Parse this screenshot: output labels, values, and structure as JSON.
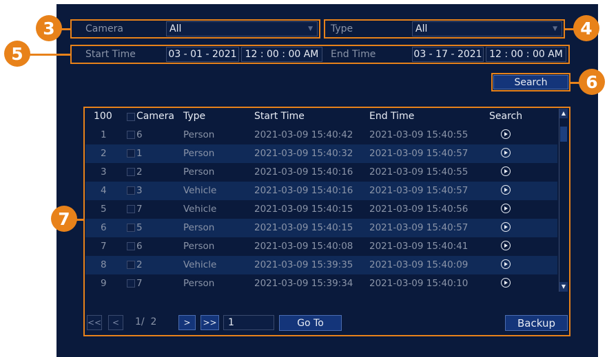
{
  "filters": {
    "camera_label": "Camera",
    "camera_value": "All",
    "type_label": "Type",
    "type_value": "All",
    "start_label": "Start Time",
    "start_date": "03 - 01 - 2021",
    "start_time": "12 : 00 : 00 AM",
    "end_label": "End Time",
    "end_date": "03 - 17 - 2021",
    "end_time": "12 : 00 : 00 AM"
  },
  "search_button": "Search",
  "callouts": [
    "3",
    "4",
    "5",
    "6",
    "7"
  ],
  "table": {
    "headers": {
      "count": "100",
      "camera": "Camera",
      "type": "Type",
      "start": "Start Time",
      "end": "End Time",
      "search": "Search"
    },
    "rows": [
      {
        "n": "1",
        "cam": "6",
        "type": "Person",
        "start": "2021-03-09 15:40:42",
        "end": "2021-03-09 15:40:55"
      },
      {
        "n": "2",
        "cam": "1",
        "type": "Person",
        "start": "2021-03-09 15:40:32",
        "end": "2021-03-09 15:40:57"
      },
      {
        "n": "3",
        "cam": "2",
        "type": "Person",
        "start": "2021-03-09 15:40:16",
        "end": "2021-03-09 15:40:55"
      },
      {
        "n": "4",
        "cam": "3",
        "type": "Vehicle",
        "start": "2021-03-09 15:40:16",
        "end": "2021-03-09 15:40:57"
      },
      {
        "n": "5",
        "cam": "7",
        "type": "Vehicle",
        "start": "2021-03-09 15:40:15",
        "end": "2021-03-09 15:40:56"
      },
      {
        "n": "6",
        "cam": "5",
        "type": "Person",
        "start": "2021-03-09 15:40:15",
        "end": "2021-03-09 15:40:57"
      },
      {
        "n": "7",
        "cam": "6",
        "type": "Person",
        "start": "2021-03-09 15:40:08",
        "end": "2021-03-09 15:40:41"
      },
      {
        "n": "8",
        "cam": "2",
        "type": "Vehicle",
        "start": "2021-03-09 15:39:35",
        "end": "2021-03-09 15:40:09"
      },
      {
        "n": "9",
        "cam": "7",
        "type": "Person",
        "start": "2021-03-09 15:39:34",
        "end": "2021-03-09 15:40:10"
      }
    ]
  },
  "pagination": {
    "first": "<<",
    "prev": "<",
    "page_info": "1/  2",
    "next": ">",
    "last": ">>",
    "page_input": "1",
    "goto": "Go To"
  },
  "backup_button": "Backup",
  "colors": {
    "accent": "#e8821a",
    "panel": "#0a1a3c",
    "row_alt": "#102a58"
  }
}
